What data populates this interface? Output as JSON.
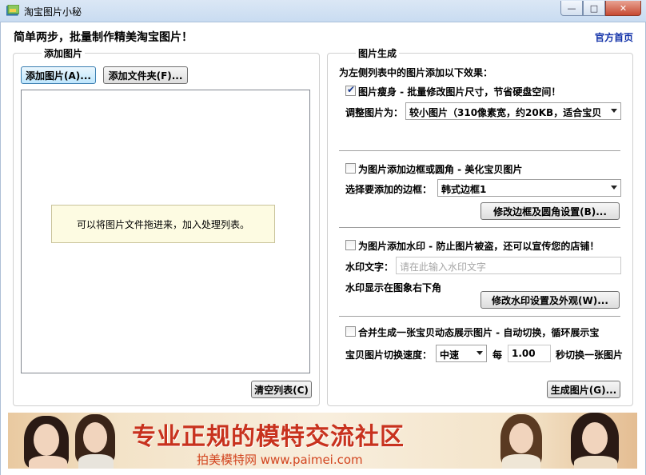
{
  "window": {
    "title": "淘宝图片小秘"
  },
  "header": {
    "headline": "简单两步，批量制作精美淘宝图片！",
    "home_link": "官方首页"
  },
  "add_panel": {
    "title": "添加图片",
    "add_images_button": "添加图片(A)...",
    "add_folder_button": "添加文件夹(F)...",
    "drop_hint": "可以将图片文件拖进来，加入处理列表。",
    "clear_button": "清空列表(C)"
  },
  "gen_panel": {
    "title": "图片生成",
    "intro": "为左侧列表中的图片添加以下效果：",
    "resize": {
      "checked": true,
      "label": "图片瘦身 - 批量修改图片尺寸，节省硬盘空间！",
      "size_label": "调整图片为：",
      "size_value": "较小图片（310像素宽，约20KB，适合宝贝"
    },
    "border": {
      "checked": false,
      "label": "为图片添加边框或圆角 - 美化宝贝图片",
      "select_label": "选择要添加的边框：",
      "select_value": "韩式边框1",
      "settings_button": "修改边框及圆角设置(B)..."
    },
    "watermark": {
      "checked": false,
      "label": "为图片添加水印 - 防止图片被盗，还可以宣传您的店铺！",
      "text_label": "水印文字：",
      "text_placeholder": "请在此输入水印文字",
      "position_text": "水印显示在图象右下角",
      "settings_button": "修改水印设置及外观(W)..."
    },
    "merge": {
      "checked": false,
      "label": "合并生成一张宝贝动态展示图片 - 自动切换，循环展示宝",
      "speed_label": "宝贝图片切换速度：",
      "speed_value": "中速",
      "every_label": "每",
      "interval_value": "1.00",
      "interval_suffix": "秒切换一张图片"
    },
    "generate_button": "生成图片(G)..."
  },
  "banner": {
    "main_text": "专业正规的模特交流社区",
    "sub_text": "拍美模特网 www.paimei.com"
  },
  "colors": {
    "link": "#1030a8",
    "banner_red": "#c8321e",
    "hint_bg": "#fdfbe2"
  }
}
